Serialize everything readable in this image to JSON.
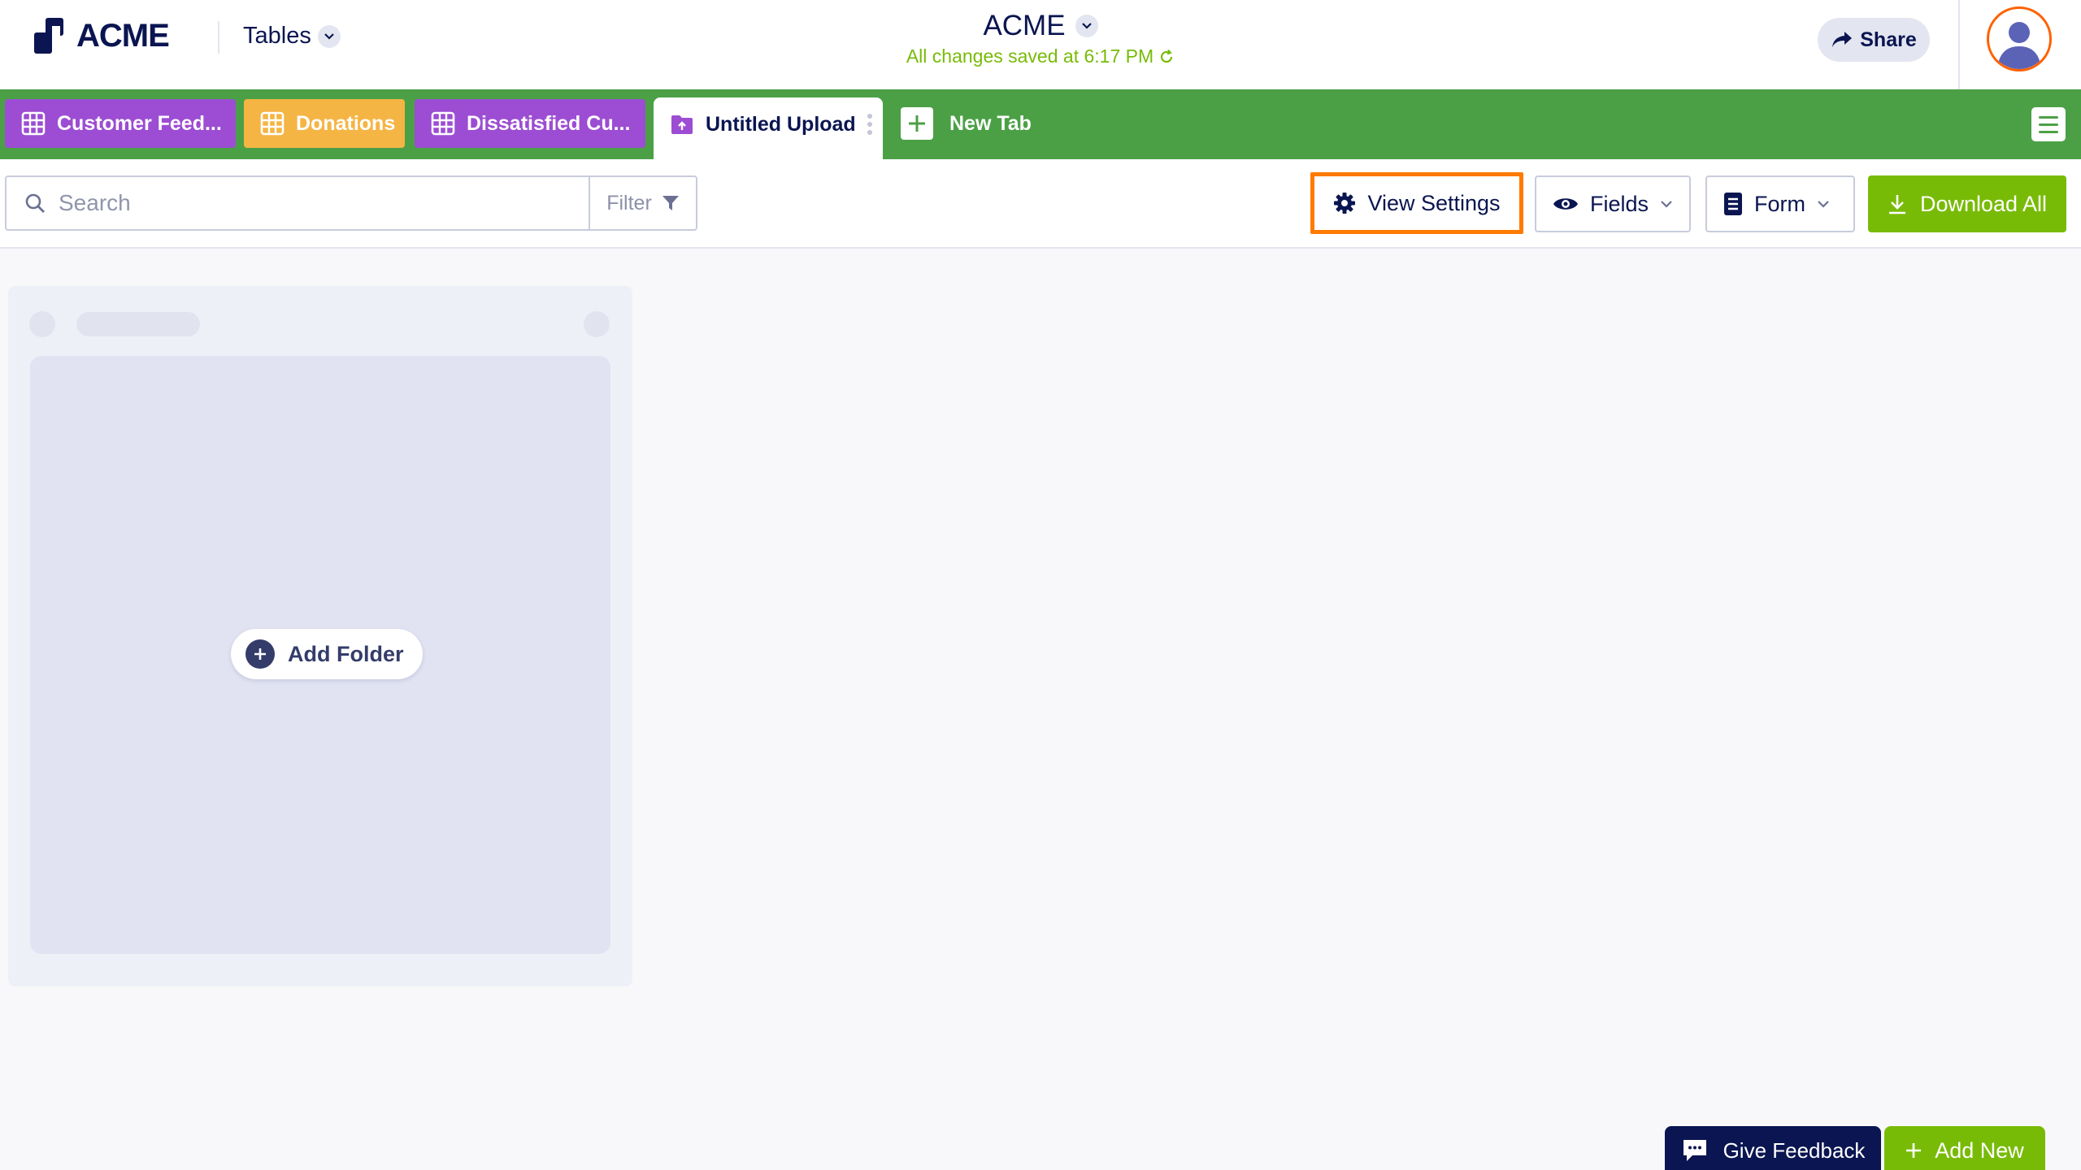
{
  "header": {
    "logo_text": "ACME",
    "tables_label": "Tables",
    "app_title": "ACME",
    "save_status": "All changes saved at 6:17 PM",
    "share_label": "Share"
  },
  "tabs": [
    {
      "label": "Customer Feed...",
      "color": "#9c4dd3",
      "icon": "table-grid-icon"
    },
    {
      "label": "Donations",
      "color": "#f5b544",
      "icon": "table-grid-icon"
    },
    {
      "label": "Dissatisfied Cu...",
      "color": "#9c4dd3",
      "icon": "table-grid-icon"
    },
    {
      "label": "Untitled Upload",
      "color": "#9c4dd3",
      "icon": "upload-folder-icon",
      "active": true
    }
  ],
  "new_tab_label": "New Tab",
  "toolbar": {
    "search_placeholder": "Search",
    "filter_label": "Filter",
    "view_settings_label": "View Settings",
    "fields_label": "Fields",
    "form_label": "Form",
    "download_label": "Download All"
  },
  "content": {
    "add_folder_label": "Add Folder"
  },
  "footer": {
    "feedback_label": "Give Feedback",
    "add_new_label": "Add New"
  },
  "colors": {
    "brand_navy": "#0a1551",
    "tabbar_green": "#4ba046",
    "action_green": "#78bb07",
    "highlight_orange": "#ff7a00",
    "tab_purple": "#9c4dd3",
    "tab_yellow": "#f5b544"
  }
}
